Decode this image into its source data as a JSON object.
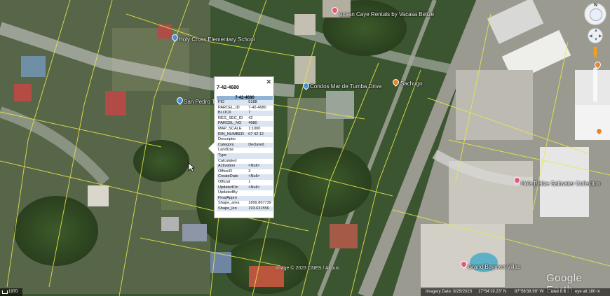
{
  "map": {
    "poi_labels": [
      {
        "id": "vacasa",
        "text": "ocean Caye Rentals by Vacasa Belize"
      },
      {
        "id": "school",
        "text": "Holy Cross Elementary School"
      },
      {
        "id": "mar",
        "text": "Condos Mar de Tumba Drive"
      },
      {
        "id": "sachugo",
        "text": "Sachugo"
      },
      {
        "id": "sanpedro",
        "text": "San Pedro Tow"
      },
      {
        "id": "collection",
        "text": "Hola Belize Saltwater Collection"
      },
      {
        "id": "grand",
        "text": "Grand Baymen Villas"
      }
    ],
    "pin_colors": {
      "shop": "#e05a7a",
      "lodging": "#e6862d",
      "poi": "#4b8fd6"
    },
    "credit": "Image © 2023 CNES / Airbus",
    "watermark": "Google Earth"
  },
  "popup": {
    "title": "7-42-4680",
    "header": "7-42-4680",
    "rows": [
      {
        "field": "FID",
        "value": "5188"
      },
      {
        "field": "PARCEL_ID",
        "value": "7-42-4680"
      },
      {
        "field": "BLOCK",
        "value": "7"
      },
      {
        "field": "REG_SEC_ID",
        "value": "42"
      },
      {
        "field": "PARCEL_NO",
        "value": "4680"
      },
      {
        "field": "MAP_SCALE",
        "value": "1:1000"
      },
      {
        "field": "RIN_NUMBER",
        "value": "07 42 12"
      },
      {
        "field": "Descriptio",
        "value": ""
      },
      {
        "field": "Category",
        "value": "Declared"
      },
      {
        "field": "LandUse",
        "value": ""
      },
      {
        "field": "Type",
        "value": ""
      },
      {
        "field": "Calculated",
        "value": ""
      },
      {
        "field": "Activation",
        "value": "<Null>"
      },
      {
        "field": "OfficeID",
        "value": "3"
      },
      {
        "field": "CreateDate",
        "value": "<Null>"
      },
      {
        "field": "Official",
        "value": "1"
      },
      {
        "field": "UpdatedOn",
        "value": "<Null>"
      },
      {
        "field": "UpdatedBy",
        "value": ""
      },
      {
        "field": "FinalAppro",
        "value": ""
      },
      {
        "field": "Shape_area",
        "value": "1899.867739"
      },
      {
        "field": "Shape_len",
        "value": "193.631556"
      }
    ],
    "close_glyph": "✕"
  },
  "status": {
    "scale": "1970",
    "imagery_date": "Imagery Date: 8/25/2023",
    "lat": "17°54'19.23\" N",
    "lon": "87°58'38.99\" W",
    "elev": "elev 0 ft",
    "eye_alt": "eye alt 180 m"
  },
  "nav": {
    "compass_letter": "N",
    "compass_icon": "compass-icon",
    "look_icon": "look-joystick-icon",
    "move_icon": "move-joystick-icon",
    "zoom_icon": "zoom-slider-icon",
    "pegman_icon": "pegman-icon"
  }
}
